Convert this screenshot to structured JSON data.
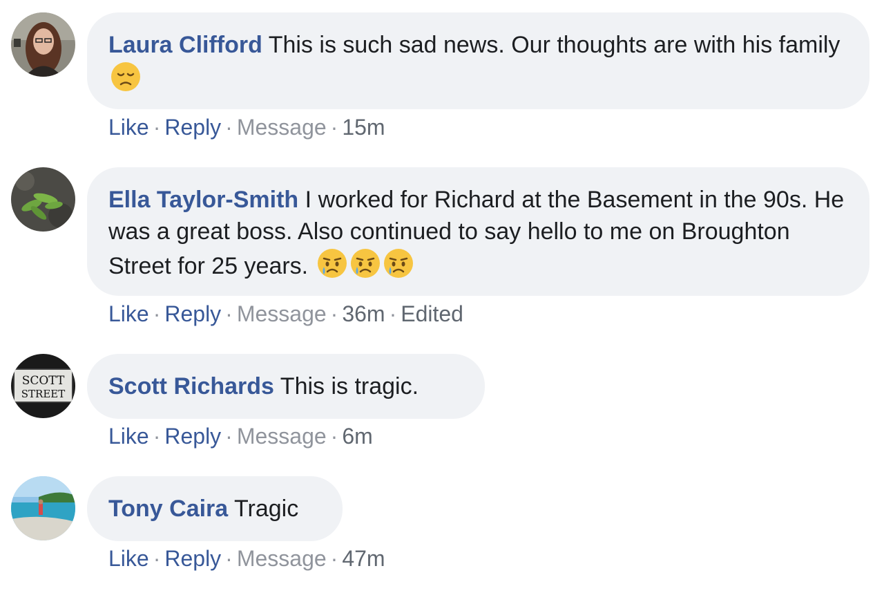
{
  "comments": [
    {
      "author": "Laura Clifford",
      "text": "This is such sad news. Our thoughts are with his family",
      "emoji": [
        "disappointed-face"
      ],
      "like": "Like",
      "reply": "Reply",
      "message": "Message",
      "time": "15m",
      "edited": ""
    },
    {
      "author": "Ella Taylor-Smith",
      "text": "I worked for Richard at the Basement in the 90s. He was a great boss. Also continued to say hello to me on Broughton Street for 25 years.",
      "emoji": [
        "crying-face",
        "crying-face",
        "crying-face"
      ],
      "like": "Like",
      "reply": "Reply",
      "message": "Message",
      "time": "36m",
      "edited": "Edited"
    },
    {
      "author": "Scott Richards",
      "text": "This is tragic.",
      "avatar_text": [
        "SCOTT",
        "STREET"
      ],
      "like": "Like",
      "reply": "Reply",
      "message": "Message",
      "time": "6m",
      "edited": ""
    },
    {
      "author": "Tony Caira",
      "text": "Tragic",
      "like": "Like",
      "reply": "Reply",
      "message": "Message",
      "time": "47m",
      "edited": ""
    }
  ],
  "colors": {
    "author": "#385898",
    "bubble": "#f0f2f5",
    "meta": "#90949c",
    "text": "#1c1e21"
  }
}
